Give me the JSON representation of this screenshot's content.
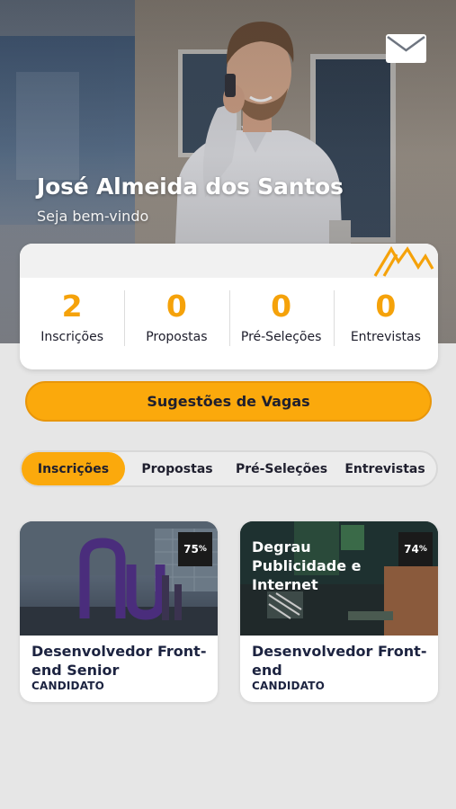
{
  "header": {
    "user_name": "José Almeida dos Santos",
    "greeting": "Seja bem-vindo",
    "mail_icon": "mail-icon"
  },
  "stats": [
    {
      "value": "2",
      "label": "Inscrições"
    },
    {
      "value": "0",
      "label": "Propostas"
    },
    {
      "value": "0",
      "label": "Pré-Seleções"
    },
    {
      "value": "0",
      "label": "Entrevistas"
    }
  ],
  "suggest_button": {
    "label": "Sugestões de Vagas"
  },
  "tabs": [
    {
      "label": "Inscrições",
      "active": true
    },
    {
      "label": "Propostas",
      "active": false
    },
    {
      "label": "Pré-Seleções",
      "active": false
    },
    {
      "label": "Entrevistas",
      "active": false
    }
  ],
  "jobs": [
    {
      "title": "Desenvolvedor Front-end Senior",
      "status": "CANDIDATO",
      "match": "75",
      "match_unit": "%",
      "company_overlay": ""
    },
    {
      "title": "Desenvolvedor Front-end",
      "status": "CANDIDATO",
      "match": "74",
      "match_unit": "%",
      "company_overlay": "Degrau Publicidade e Internet"
    }
  ],
  "colors": {
    "accent": "#fba90c",
    "stat_number": "#f5a20a",
    "text_dark": "#1c2340",
    "background": "#e6e6e6"
  }
}
